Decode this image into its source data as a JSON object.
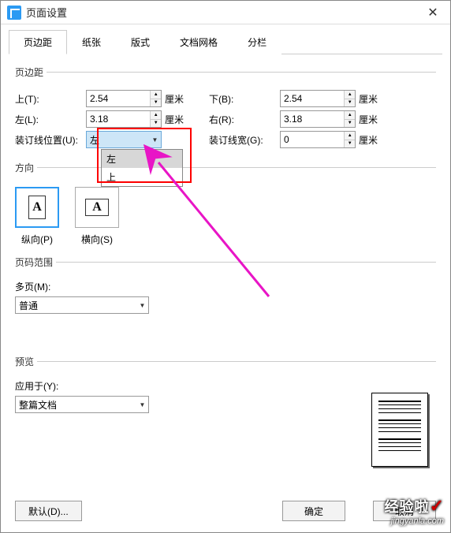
{
  "window": {
    "title": "页面设置",
    "close": "✕"
  },
  "tabs": {
    "margin": "页边距",
    "paper": "纸张",
    "layout": "版式",
    "grid": "文档网格",
    "columns": "分栏"
  },
  "margins": {
    "legend": "页边距",
    "top_label": "上(T):",
    "top_value": "2.54",
    "top_unit": "厘米",
    "bottom_label": "下(B):",
    "bottom_value": "2.54",
    "bottom_unit": "厘米",
    "left_label": "左(L):",
    "left_value": "3.18",
    "left_unit": "厘米",
    "right_label": "右(R):",
    "right_value": "3.18",
    "right_unit": "厘米",
    "gutter_pos_label": "装订线位置(U):",
    "gutter_pos_value": "左",
    "gutter_options": {
      "left": "左",
      "top": "上"
    },
    "gutter_width_label": "装订线宽(G):",
    "gutter_width_value": "0",
    "gutter_width_unit": "厘米"
  },
  "orientation": {
    "legend": "方向",
    "portrait": "纵向(P)",
    "landscape": "横向(S)",
    "glyph": "A"
  },
  "page_range": {
    "legend": "页码范围",
    "multi_label": "多页(M):",
    "multi_value": "普通"
  },
  "preview": {
    "legend": "预览",
    "apply_label": "应用于(Y):",
    "apply_value": "整篇文档"
  },
  "buttons": {
    "default": "默认(D)...",
    "ok": "确定",
    "cancel": "取消"
  },
  "watermark": {
    "main": "经验啦",
    "sub": "jingyanla.com",
    "check": "✓"
  }
}
